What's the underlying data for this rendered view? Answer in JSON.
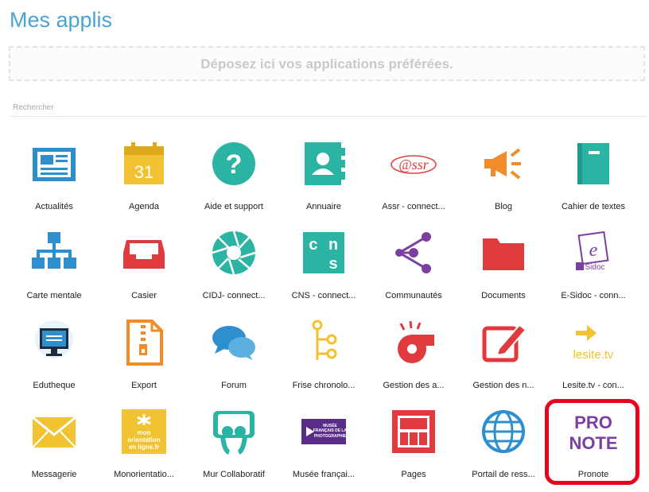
{
  "header": {
    "title": "Mes applis"
  },
  "dropzone": {
    "text": "Déposez ici vos applications préférées."
  },
  "search": {
    "placeholder": "Rechercher"
  },
  "apps": [
    {
      "label": "Actualités",
      "icon": "newspaper-icon"
    },
    {
      "label": "Agenda",
      "icon": "calendar-icon",
      "icon_text": "31"
    },
    {
      "label": "Aide et support",
      "icon": "question-icon"
    },
    {
      "label": "Annuaire",
      "icon": "contact-book-icon"
    },
    {
      "label": "Assr - connect...",
      "icon": "assr-logo-icon",
      "icon_text": "@ssr"
    },
    {
      "label": "Blog",
      "icon": "megaphone-icon"
    },
    {
      "label": "Cahier de textes",
      "icon": "notebook-icon"
    },
    {
      "label": "Carte mentale",
      "icon": "sitemap-icon"
    },
    {
      "label": "Casier",
      "icon": "inbox-tray-icon"
    },
    {
      "label": "CIDJ- connect...",
      "icon": "aperture-icon"
    },
    {
      "label": "CNS - connect...",
      "icon": "cns-logo-icon",
      "icon_text": "c n s"
    },
    {
      "label": "Communautés",
      "icon": "share-nodes-icon"
    },
    {
      "label": "Documents",
      "icon": "folder-icon"
    },
    {
      "label": "E-Sidoc - conn...",
      "icon": "esidoc-logo-icon",
      "icon_text": "e-Sidoc"
    },
    {
      "label": "Edutheque",
      "icon": "monitor-icon"
    },
    {
      "label": "Export",
      "icon": "zip-file-icon"
    },
    {
      "label": "Forum",
      "icon": "chat-bubbles-icon"
    },
    {
      "label": "Frise chronolo...",
      "icon": "timeline-icon"
    },
    {
      "label": "Gestion des a...",
      "icon": "whistle-icon"
    },
    {
      "label": "Gestion des n...",
      "icon": "edit-pencil-icon"
    },
    {
      "label": "Lesite.tv - con...",
      "icon": "lesite-logo-icon",
      "icon_text": "lesite.tv"
    },
    {
      "label": "Messagerie",
      "icon": "envelope-icon"
    },
    {
      "label": "Monorientatio...",
      "icon": "monorientation-logo-icon",
      "icon_text": "mon orientation en ligne.fr"
    },
    {
      "label": "Mur Collaboratif",
      "icon": "slideshare-icon"
    },
    {
      "label": "Musée françai...",
      "icon": "musee-photo-logo-icon",
      "icon_text": "MUSÉE FRANÇAIS DE LA PHOTOGRAPHIE"
    },
    {
      "label": "Pages",
      "icon": "web-page-icon"
    },
    {
      "label": "Portail de ress...",
      "icon": "globe-icon"
    },
    {
      "label": "Pronote",
      "icon": "pronote-logo-icon",
      "icon_text": "PRO NOTE"
    }
  ],
  "colors": {
    "title": "#4aa3d3",
    "teal": "#2bb3a3",
    "blue": "#2e8fcf",
    "yellow": "#f1c232",
    "red": "#e03a3e",
    "orange": "#f28c28",
    "purple": "#7b3fa0",
    "highlight": "#e8001f"
  }
}
